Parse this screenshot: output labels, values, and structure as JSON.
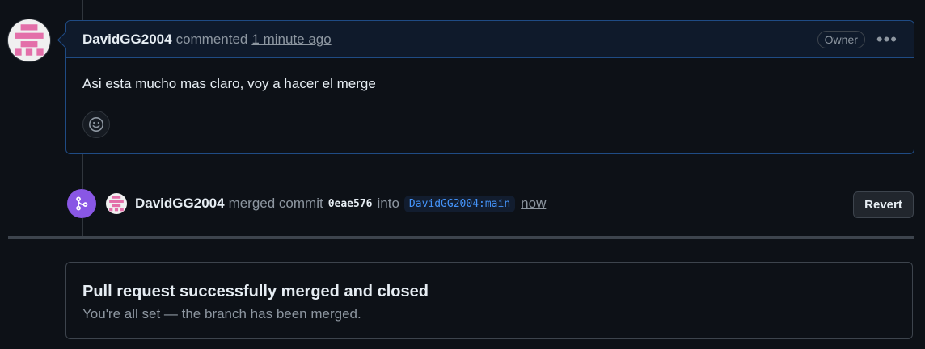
{
  "comment": {
    "author": "DavidGG2004",
    "action": "commented",
    "time": "1 minute ago",
    "role_badge": "Owner",
    "body": "Asi esta mucho mas claro, voy a hacer el merge",
    "more_icon": "kebab-horizontal-icon",
    "reaction_icon": "smiley-icon"
  },
  "merge_event": {
    "author": "DavidGG2004",
    "action": "merged commit",
    "commit_sha": "0eae576",
    "into": "into",
    "branch": "DavidGG2004:main",
    "time": "now",
    "revert_label": "Revert",
    "icon": "git-merge-icon"
  },
  "status": {
    "title": "Pull request successfully merged and closed",
    "subtitle": "You're all set — the branch has been merged."
  },
  "colors": {
    "background": "#0d1117",
    "merge_purple": "#8957e5",
    "link_blue": "#4493f8",
    "avatar_pink": "#e36fa9"
  }
}
